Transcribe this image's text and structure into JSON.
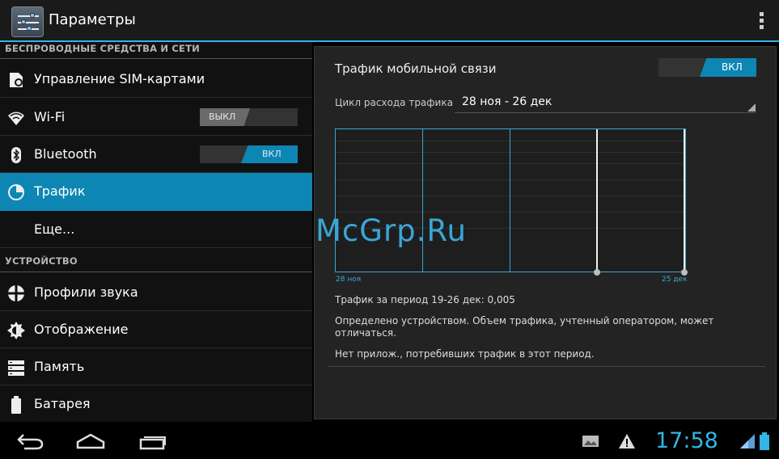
{
  "app": {
    "title": "Параметры"
  },
  "sections": {
    "wireless": "БЕСПРОВОДНЫЕ СРЕДСТВА И СЕТИ",
    "device": "УСТРОЙСТВО"
  },
  "items": [
    {
      "label": "Управление SIM-картами",
      "icon": "sim-card-icon"
    },
    {
      "label": "Wi-Fi",
      "icon": "wifi-icon",
      "toggle": "ВЫКЛ"
    },
    {
      "label": "Bluetooth",
      "icon": "bluetooth-icon",
      "toggle": "ВКЛ"
    },
    {
      "label": "Трафик",
      "icon": "data-usage-icon",
      "active": true
    },
    {
      "label": "Еще..."
    },
    {
      "label": "Профили звука",
      "icon": "sound-icon"
    },
    {
      "label": "Отображение",
      "icon": "display-icon"
    },
    {
      "label": "Память",
      "icon": "storage-icon"
    },
    {
      "label": "Батарея",
      "icon": "battery-icon"
    }
  ],
  "panel": {
    "title": "Трафик мобильной связи",
    "switch": "ВКЛ",
    "cycle_label": "Цикл расхода трафика",
    "cycle_value": "28 ноя - 26 дек",
    "date_start": "28 ноя",
    "date_end": "25 дек",
    "usage_text": "Трафик за период 19-26 дек: 0,005",
    "note": "Определено устройством. Объем трафика, учтенный оператором, может отличаться.",
    "no_apps": "Нет прилож., потребивших трафик в этот период."
  },
  "watermark": "McGrp.Ru",
  "status": {
    "clock": "17:58"
  },
  "colors": {
    "accent": "#33b5e5",
    "active": "#0e86b4"
  }
}
